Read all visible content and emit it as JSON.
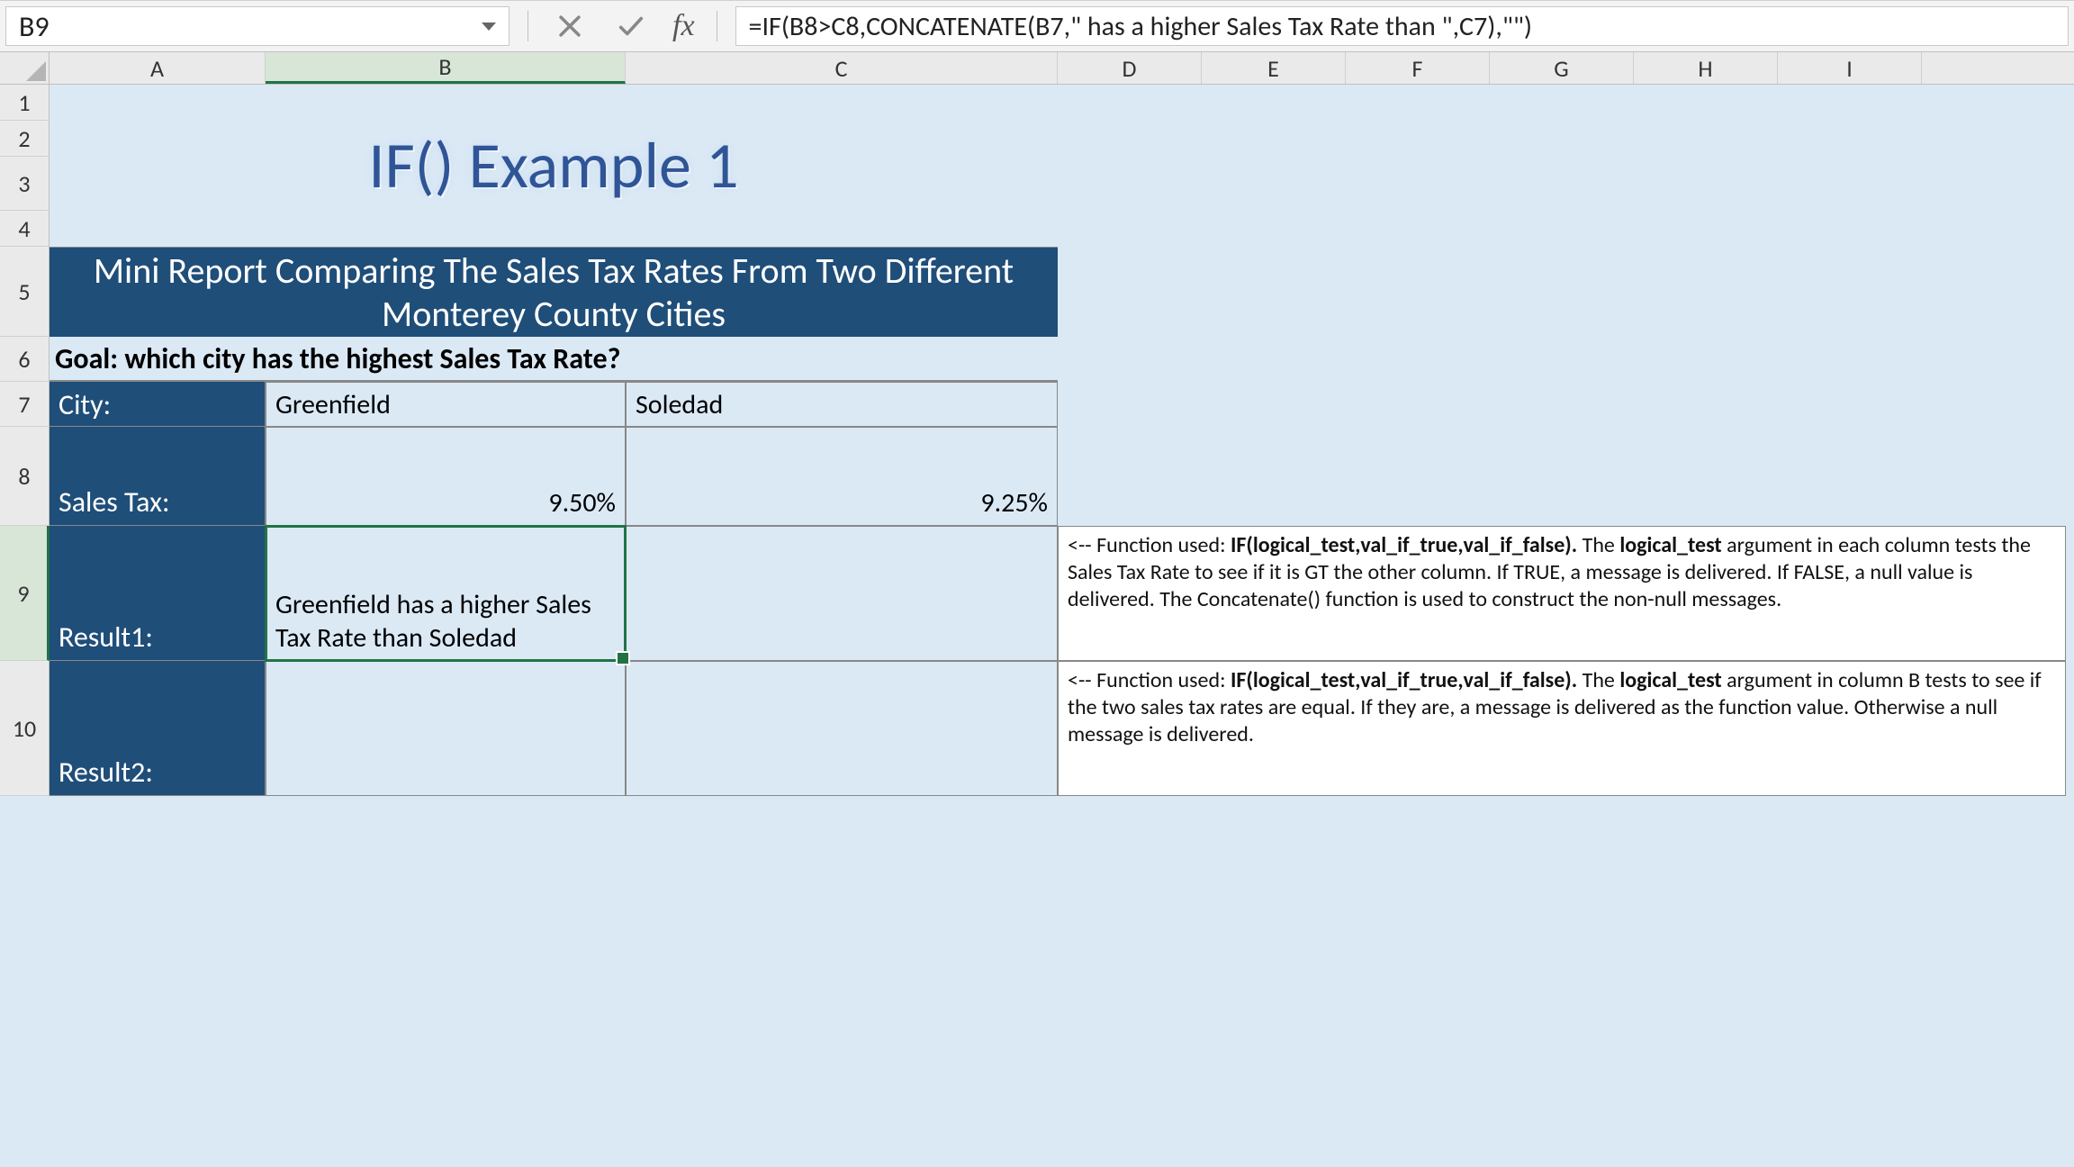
{
  "namebox": {
    "value": "B9"
  },
  "formula_bar": {
    "cancel": "×",
    "enter": "✓",
    "fx": "fx",
    "formula": "=IF(B8>C8,CONCATENATE(B7,\" has a higher Sales Tax Rate than \",C7),\"\")"
  },
  "columns": [
    "A",
    "B",
    "C",
    "D",
    "E",
    "F",
    "G",
    "H",
    "I"
  ],
  "rows": [
    "1",
    "2",
    "3",
    "4",
    "5",
    "6",
    "7",
    "8",
    "9",
    "10"
  ],
  "content": {
    "title": "IF() Example 1",
    "subtitle": "Mini Report Comparing The Sales Tax Rates From Two Different Monterey County Cities",
    "goal": "Goal: which city has the highest Sales Tax Rate?",
    "labels": {
      "city": "City:",
      "salestax": "Sales Tax:",
      "result1": "Result1:",
      "result2": "Result2:"
    },
    "row7": {
      "B": "Greenfield",
      "C": "Soledad"
    },
    "row8": {
      "B": "9.50%",
      "C": "9.25%"
    },
    "row9": {
      "B": "Greenfield has a higher Sales Tax Rate than Soledad",
      "C": ""
    },
    "row10": {
      "B": "",
      "C": ""
    },
    "note9_prefix": "<-- Function used: ",
    "note9_func": "IF(logical_test,val_if_true,val_if_false).",
    "note9_mid": " The ",
    "note9_bold2": "logical_test",
    "note9_rest": " argument in each column tests the Sales Tax Rate to see if it is GT the other column. If TRUE, a message is delivered. If FALSE, a null value is delivered. The Concatenate() function is used to construct the non-null messages.",
    "note10_prefix": "<-- Function used: ",
    "note10_func": "IF(logical_test,val_if_true,val_if_false).",
    "note10_mid": " The ",
    "note10_bold2": "logical_test",
    "note10_rest": " argument in column B tests to see if the two sales tax rates are equal. If they are, a message is delivered as the function value. Otherwise a null message is delivered."
  }
}
